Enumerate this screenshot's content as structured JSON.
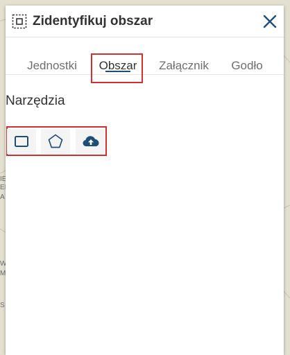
{
  "panel": {
    "title": "Zidentyfikuj obszar",
    "header_icon": "select-area-icon",
    "close_icon": "close-icon"
  },
  "tabs": [
    {
      "label": "Jednostki",
      "active": false
    },
    {
      "label": "Obszar",
      "active": true
    },
    {
      "label": "Załącznik",
      "active": false
    },
    {
      "label": "Godło",
      "active": false
    }
  ],
  "tools": {
    "section_label": "Narzędzia",
    "items": [
      {
        "icon": "rectangle-icon"
      },
      {
        "icon": "polygon-icon"
      },
      {
        "icon": "cloud-upload-icon"
      }
    ]
  },
  "map_labels": [
    "IE",
    "EI",
    "A",
    "W",
    "M",
    "S"
  ],
  "colors": {
    "accent": "#1f4d7a",
    "highlight": "#d32f2f",
    "text": "#323232",
    "muted_text": "#6e6e6e"
  }
}
